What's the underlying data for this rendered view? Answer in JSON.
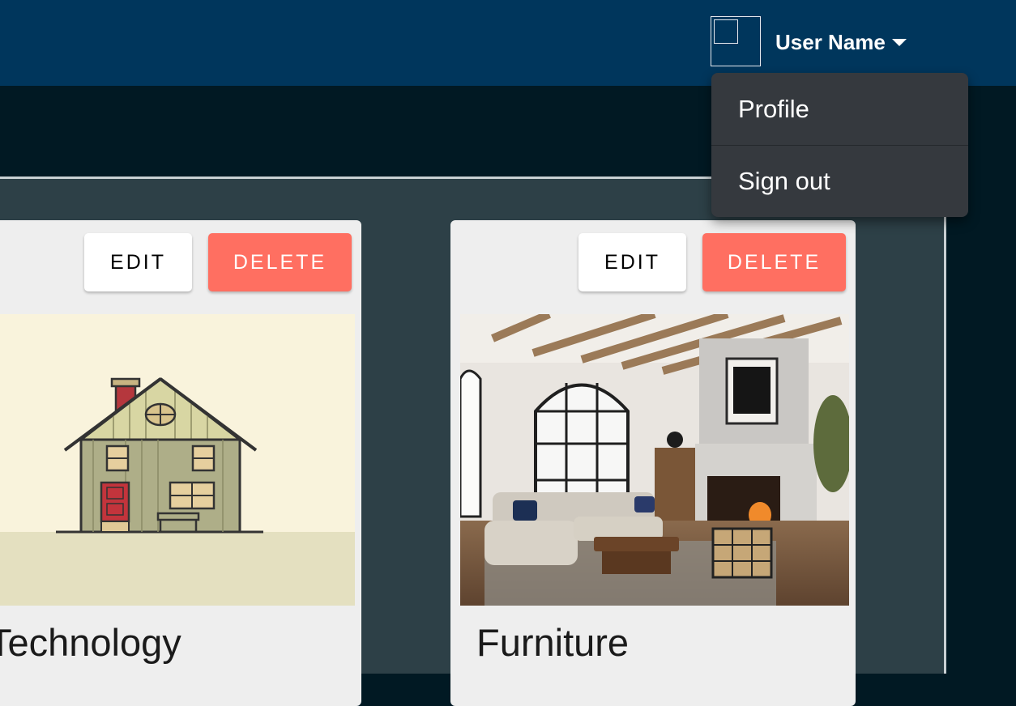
{
  "header": {
    "user_name": "User Name",
    "avatar_icon": "avatar-placeholder-icon",
    "caret_icon": "caret-down-icon",
    "background_color": "#00365c"
  },
  "user_menu": {
    "items": [
      {
        "label": "Profile"
      },
      {
        "label": "Sign out"
      }
    ],
    "background_color": "#35393e"
  },
  "cards": [
    {
      "title": "Technology",
      "edit_label": "EDIT",
      "delete_label": "DELETE",
      "image": "illustrated-house"
    },
    {
      "title": "Furniture",
      "edit_label": "EDIT",
      "delete_label": "DELETE",
      "image": "living-room-photo"
    }
  ],
  "colors": {
    "delete_button": "#ff6f61",
    "edit_button": "#ffffff",
    "content_background": "#2d4047",
    "card_background": "#eeeeee"
  }
}
